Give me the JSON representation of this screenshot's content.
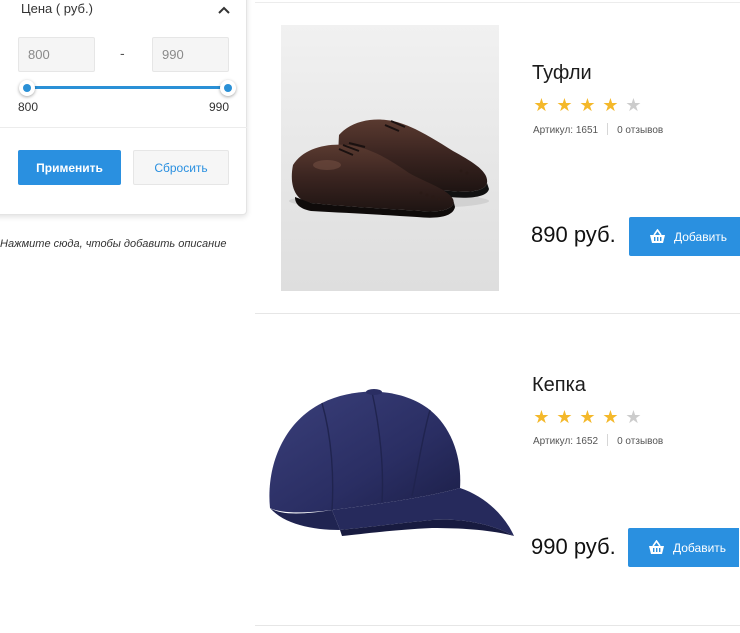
{
  "filter": {
    "title": "Цена ( руб.)",
    "min_value": "800",
    "max_value": "990",
    "range_separator": "-",
    "slider_min_label": "800",
    "slider_max_label": "990",
    "apply_label": "Применить",
    "reset_label": "Сбросить",
    "accent_color": "#2a90e0"
  },
  "description_hint": "Нажмите сюда, чтобы добавить описание",
  "products": [
    {
      "title": "Туфли",
      "rating": 4,
      "rating_max": 5,
      "article": "Артикул: 1651",
      "reviews": "0 отзывов",
      "price": "890 руб.",
      "add_label": "Добавить",
      "image": "brown-brogue-shoes"
    },
    {
      "title": "Кепка",
      "rating": 4,
      "rating_max": 5,
      "article": "Артикул: 1652",
      "reviews": "0 отзывов",
      "price": "990 руб.",
      "add_label": "Добавить",
      "image": "navy-baseball-cap"
    }
  ]
}
